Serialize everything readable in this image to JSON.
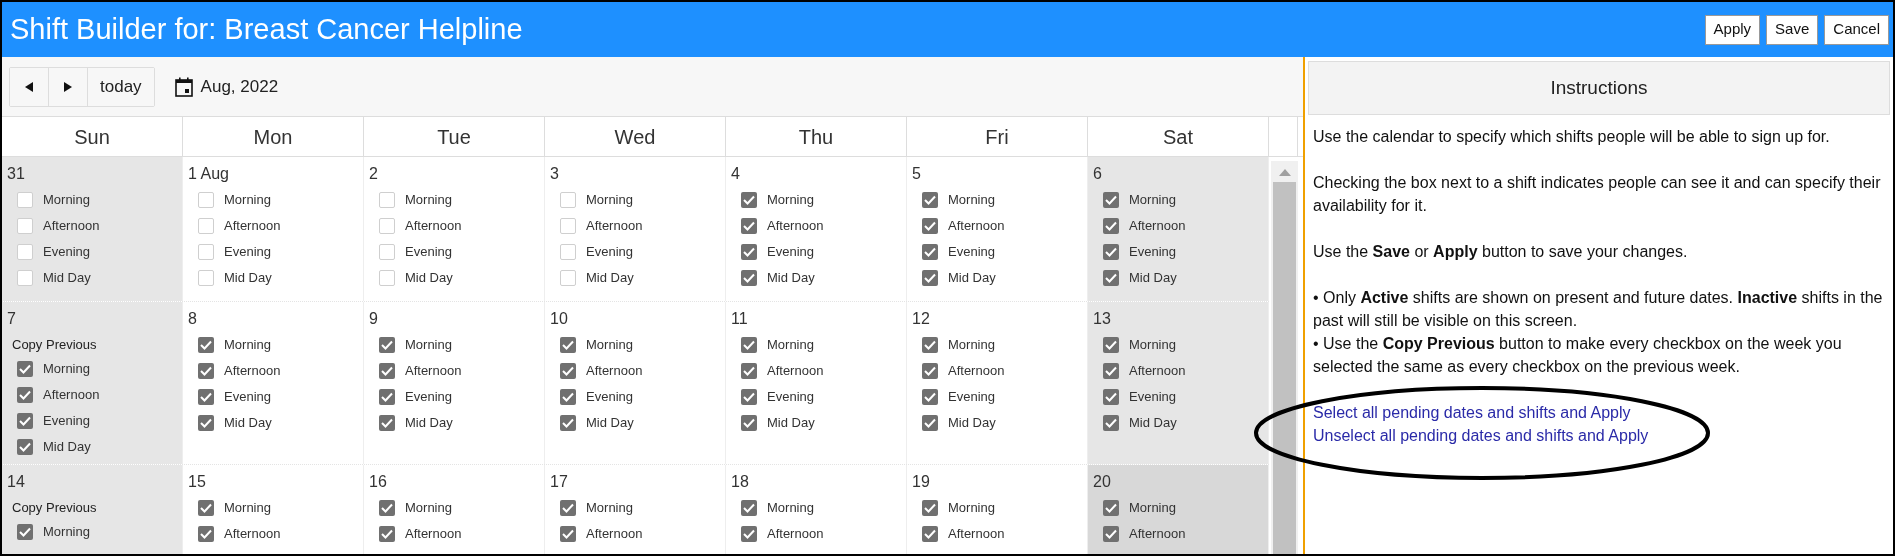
{
  "header": {
    "title": "Shift Builder for: Breast Cancer Helpline",
    "buttons": [
      "Apply",
      "Save",
      "Cancel"
    ]
  },
  "toolbar": {
    "today": "today",
    "month": "Aug, 2022"
  },
  "calendar": {
    "days": [
      "Sun",
      "Mon",
      "Tue",
      "Wed",
      "Thu",
      "Fri",
      "Sat"
    ],
    "weeks": [
      {
        "cells": [
          {
            "date": "31",
            "weekend": true,
            "today": false,
            "shifts": [
              {
                "label": "Morning",
                "checked": false
              },
              {
                "label": "Afternoon",
                "checked": false
              },
              {
                "label": "Evening",
                "checked": false
              },
              {
                "label": "Mid Day",
                "checked": false
              }
            ]
          },
          {
            "date": "1 Aug",
            "weekend": false,
            "today": false,
            "shifts": [
              {
                "label": "Morning",
                "checked": false
              },
              {
                "label": "Afternoon",
                "checked": false
              },
              {
                "label": "Evening",
                "checked": false
              },
              {
                "label": "Mid Day",
                "checked": false
              }
            ]
          },
          {
            "date": "2",
            "weekend": false,
            "today": false,
            "shifts": [
              {
                "label": "Morning",
                "checked": false
              },
              {
                "label": "Afternoon",
                "checked": false
              },
              {
                "label": "Evening",
                "checked": false
              },
              {
                "label": "Mid Day",
                "checked": false
              }
            ]
          },
          {
            "date": "3",
            "weekend": false,
            "today": false,
            "shifts": [
              {
                "label": "Morning",
                "checked": false
              },
              {
                "label": "Afternoon",
                "checked": false
              },
              {
                "label": "Evening",
                "checked": false
              },
              {
                "label": "Mid Day",
                "checked": false
              }
            ]
          },
          {
            "date": "4",
            "weekend": false,
            "today": false,
            "shifts": [
              {
                "label": "Morning",
                "checked": true
              },
              {
                "label": "Afternoon",
                "checked": true
              },
              {
                "label": "Evening",
                "checked": true
              },
              {
                "label": "Mid Day",
                "checked": true
              }
            ]
          },
          {
            "date": "5",
            "weekend": false,
            "today": false,
            "shifts": [
              {
                "label": "Morning",
                "checked": true
              },
              {
                "label": "Afternoon",
                "checked": true
              },
              {
                "label": "Evening",
                "checked": true
              },
              {
                "label": "Mid Day",
                "checked": true
              }
            ]
          },
          {
            "date": "6",
            "weekend": true,
            "today": false,
            "shifts": [
              {
                "label": "Morning",
                "checked": true
              },
              {
                "label": "Afternoon",
                "checked": true
              },
              {
                "label": "Evening",
                "checked": true
              },
              {
                "label": "Mid Day",
                "checked": true
              }
            ]
          }
        ]
      },
      {
        "cells": [
          {
            "date": "7",
            "weekend": true,
            "today": false,
            "copy_button": "Copy Previous",
            "shifts": [
              {
                "label": "Morning",
                "checked": true
              },
              {
                "label": "Afternoon",
                "checked": true
              },
              {
                "label": "Evening",
                "checked": true
              },
              {
                "label": "Mid Day",
                "checked": true
              }
            ]
          },
          {
            "date": "8",
            "weekend": false,
            "today": false,
            "shifts": [
              {
                "label": "Morning",
                "checked": true
              },
              {
                "label": "Afternoon",
                "checked": true
              },
              {
                "label": "Evening",
                "checked": true
              },
              {
                "label": "Mid Day",
                "checked": true
              }
            ]
          },
          {
            "date": "9",
            "weekend": false,
            "today": false,
            "shifts": [
              {
                "label": "Morning",
                "checked": true
              },
              {
                "label": "Afternoon",
                "checked": true
              },
              {
                "label": "Evening",
                "checked": true
              },
              {
                "label": "Mid Day",
                "checked": true
              }
            ]
          },
          {
            "date": "10",
            "weekend": false,
            "today": false,
            "shifts": [
              {
                "label": "Morning",
                "checked": true
              },
              {
                "label": "Afternoon",
                "checked": true
              },
              {
                "label": "Evening",
                "checked": true
              },
              {
                "label": "Mid Day",
                "checked": true
              }
            ]
          },
          {
            "date": "11",
            "weekend": false,
            "today": false,
            "shifts": [
              {
                "label": "Morning",
                "checked": true
              },
              {
                "label": "Afternoon",
                "checked": true
              },
              {
                "label": "Evening",
                "checked": true
              },
              {
                "label": "Mid Day",
                "checked": true
              }
            ]
          },
          {
            "date": "12",
            "weekend": false,
            "today": false,
            "shifts": [
              {
                "label": "Morning",
                "checked": true
              },
              {
                "label": "Afternoon",
                "checked": true
              },
              {
                "label": "Evening",
                "checked": true
              },
              {
                "label": "Mid Day",
                "checked": true
              }
            ]
          },
          {
            "date": "13",
            "weekend": true,
            "today": false,
            "shifts": [
              {
                "label": "Morning",
                "checked": true
              },
              {
                "label": "Afternoon",
                "checked": true
              },
              {
                "label": "Evening",
                "checked": true
              },
              {
                "label": "Mid Day",
                "checked": true
              }
            ]
          }
        ]
      },
      {
        "cells": [
          {
            "date": "14",
            "weekend": true,
            "today": false,
            "copy_button": "Copy Previous",
            "shifts": [
              {
                "label": "Morning",
                "checked": true
              }
            ]
          },
          {
            "date": "15",
            "weekend": false,
            "today": false,
            "shifts": [
              {
                "label": "Morning",
                "checked": true
              },
              {
                "label": "Afternoon",
                "checked": true
              }
            ]
          },
          {
            "date": "16",
            "weekend": false,
            "today": false,
            "shifts": [
              {
                "label": "Morning",
                "checked": true
              },
              {
                "label": "Afternoon",
                "checked": true
              }
            ]
          },
          {
            "date": "17",
            "weekend": false,
            "today": false,
            "shifts": [
              {
                "label": "Morning",
                "checked": true
              },
              {
                "label": "Afternoon",
                "checked": true
              }
            ]
          },
          {
            "date": "18",
            "weekend": false,
            "today": false,
            "shifts": [
              {
                "label": "Morning",
                "checked": true
              },
              {
                "label": "Afternoon",
                "checked": true
              }
            ]
          },
          {
            "date": "19",
            "weekend": false,
            "today": false,
            "shifts": [
              {
                "label": "Morning",
                "checked": true
              },
              {
                "label": "Afternoon",
                "checked": true
              }
            ]
          },
          {
            "date": "20",
            "weekend": true,
            "today": true,
            "shifts": [
              {
                "label": "Morning",
                "checked": true
              },
              {
                "label": "Afternoon",
                "checked": true
              }
            ]
          }
        ]
      }
    ]
  },
  "instructions": {
    "title": "Instructions",
    "paragraphs": [
      "Use the calendar to specify which shifts people will be able to sign up for.",
      "Checking the box next to a shift indicates people can see it and can specify their availability for it.",
      "Use the **Save** or **Apply** button to save your changes."
    ],
    "bullets": [
      "• Only **Active** shifts are shown on present and future dates. **Inactive** shifts in the past will still be visible on this screen.",
      "• Use the **Copy Previous** button to make every checkbox on the week you selected the same as every checkbox on the previous week."
    ],
    "links": [
      "Select all pending dates and shifts and Apply",
      "Unselect all pending dates and shifts and Apply"
    ]
  }
}
